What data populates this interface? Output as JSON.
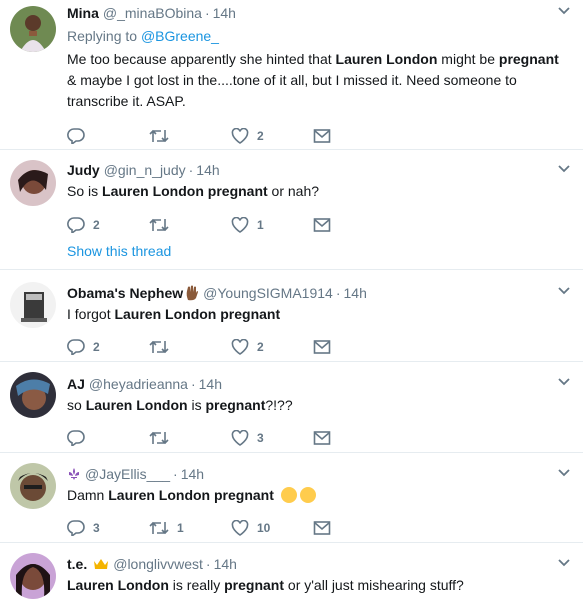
{
  "tweets": [
    {
      "name": "Mina",
      "handle": "@_minaBObina",
      "dot": "·",
      "time": "14h",
      "replying_prefix": "Replying to",
      "replying_handle": "@BGreene_",
      "text_parts": [
        "Me too because apparently she hinted that ",
        "Lauren London",
        " might be ",
        "pregnant",
        " & maybe I got lost in the....tone of it all, but I missed it. Need someone to transcribe it. ASAP."
      ],
      "reply_count": "",
      "retweet_count": "",
      "like_count": "2"
    },
    {
      "name": "Judy",
      "handle": "@gin_n_judy",
      "dot": "·",
      "time": "14h",
      "text_parts": [
        "So is ",
        "Lauren London pregnant",
        " or nah?"
      ],
      "reply_count": "2",
      "retweet_count": "",
      "like_count": "1",
      "show_thread": "Show this thread"
    },
    {
      "name": "Obama's Nephew",
      "handle": "@YoungSIGMA1914",
      "dot": "·",
      "time": "14h",
      "text_parts": [
        "I forgot ",
        "Lauren London pregnant"
      ],
      "reply_count": "2",
      "retweet_count": "",
      "like_count": "2"
    },
    {
      "name": "AJ",
      "handle": "@heyadrieanna",
      "dot": "·",
      "time": "14h",
      "text_parts": [
        "so ",
        "Lauren London",
        " is ",
        "pregnant",
        "?!??"
      ],
      "reply_count": "",
      "retweet_count": "",
      "like_count": "3"
    },
    {
      "name": "",
      "handle": "@JayEllis___",
      "dot": "·",
      "time": "14h",
      "text_parts": [
        "Damn ",
        "Lauren London pregnant"
      ],
      "reply_count": "3",
      "retweet_count": "1",
      "like_count": "10"
    },
    {
      "name": "t.e.",
      "handle": "@longlivvwest",
      "dot": "·",
      "time": "14h",
      "text_parts": [
        "Lauren London",
        " is really ",
        "pregnant",
        " or y'all just mishearing stuff?"
      ]
    }
  ],
  "icons": {
    "reply": "reply-icon",
    "retweet": "retweet-icon",
    "like": "heart-icon",
    "dm": "envelope-icon",
    "more": "chevron-down-icon"
  },
  "colors": {
    "link": "#1b95e0",
    "secondary": "#657786",
    "border": "#e6ecf0"
  }
}
